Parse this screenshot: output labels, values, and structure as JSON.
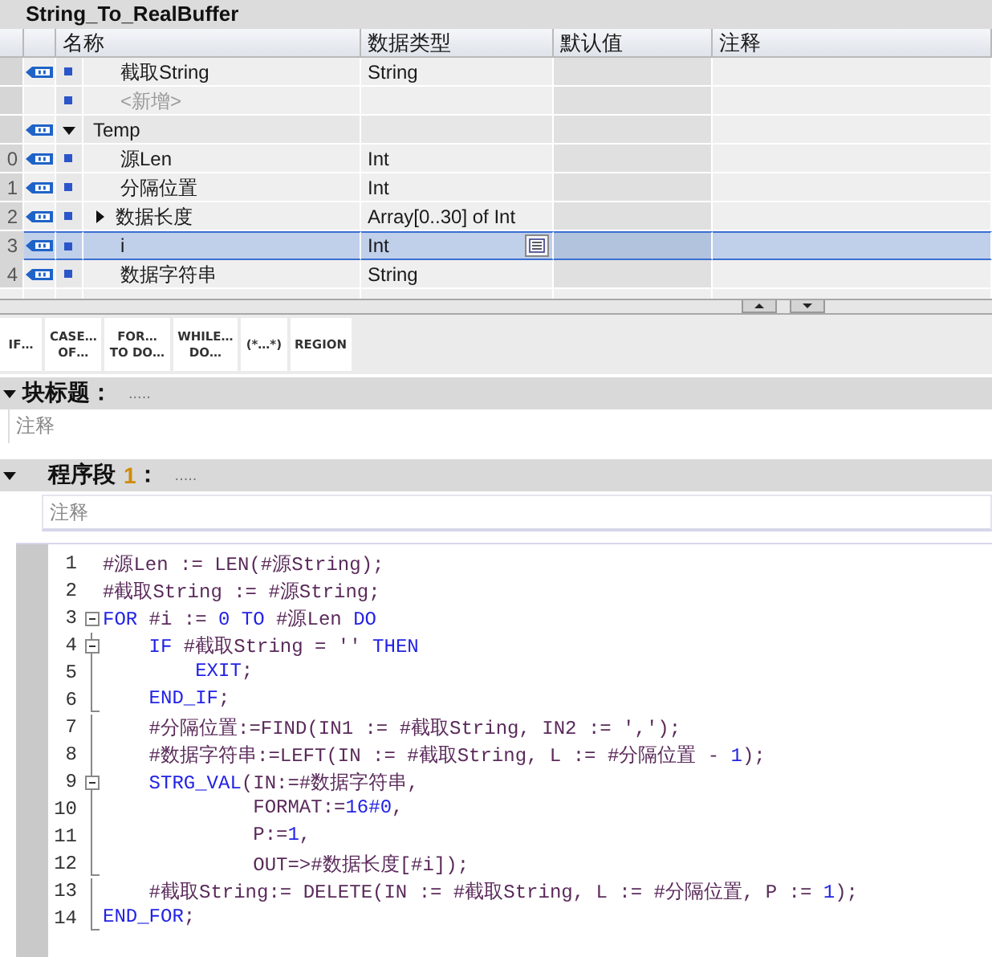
{
  "block": {
    "title": "String_To_RealBuffer"
  },
  "table": {
    "columns": [
      "名称",
      "数据类型",
      "默认值",
      "注释"
    ],
    "rows": [
      {
        "kind": "member",
        "name": "截取String",
        "type": "String",
        "selected": false
      },
      {
        "kind": "add",
        "name": "<新增>",
        "selected": false
      },
      {
        "kind": "section",
        "name": "Temp",
        "expanded": true,
        "selected": false
      },
      {
        "number": "0",
        "kind": "member",
        "name": "源Len",
        "type": "Int",
        "selected": false
      },
      {
        "number": "1",
        "kind": "member",
        "name": "分隔位置",
        "type": "Int",
        "selected": false
      },
      {
        "number": "2",
        "kind": "member",
        "name": "数据长度",
        "type": "Array[0..30] of Int",
        "expanded": false,
        "selected": false
      },
      {
        "number": "3",
        "kind": "member",
        "name": "i",
        "type": "Int",
        "selected": true
      },
      {
        "number": "4",
        "kind": "member",
        "name": "数据字符串",
        "type": "String",
        "selected": false
      }
    ]
  },
  "toolbar": {
    "buttons": [
      "IF…",
      "CASE…\nOF…",
      "FOR…\nTO DO…",
      "WHILE…\nDO…",
      "(*…*)",
      "REGION"
    ]
  },
  "block_title": {
    "label": "块标题：",
    "hint": ".....",
    "expanded": true,
    "comment": "注释"
  },
  "network": {
    "label": "程序段",
    "number": "1",
    "separator": "：",
    "hint": ".....",
    "expanded": true,
    "comment": "注释"
  },
  "code": {
    "lines": [
      {
        "number": "1",
        "foldable": false,
        "block_end": false,
        "segments": [
          {
            "kind": "plain",
            "text": "#源Len := LEN(#源String);"
          }
        ]
      },
      {
        "number": "2",
        "foldable": false,
        "block_end": false,
        "segments": [
          {
            "kind": "plain",
            "text": "#截取String := #源String;"
          }
        ]
      },
      {
        "number": "3",
        "foldable": true,
        "block_end": false,
        "segments": [
          {
            "kind": "keyword",
            "text": "FOR"
          },
          {
            "kind": "plain",
            "text": " #i := "
          },
          {
            "kind": "number",
            "text": "0"
          },
          {
            "kind": "keyword",
            "text": " TO"
          },
          {
            "kind": "plain",
            "text": " #源Len "
          },
          {
            "kind": "keyword",
            "text": "DO"
          }
        ]
      },
      {
        "number": "4",
        "foldable": true,
        "block_end": false,
        "segments": [
          {
            "kind": "keyword",
            "text": "    IF"
          },
          {
            "kind": "plain",
            "text": " #截取String = '' "
          },
          {
            "kind": "keyword",
            "text": "THEN"
          }
        ]
      },
      {
        "number": "5",
        "foldable": false,
        "block_end": false,
        "segments": [
          {
            "kind": "keyword",
            "text": "        EXIT"
          },
          {
            "kind": "plain",
            "text": ";"
          }
        ]
      },
      {
        "number": "6",
        "foldable": false,
        "block_end": true,
        "segments": [
          {
            "kind": "keyword",
            "text": "    END_IF"
          },
          {
            "kind": "plain",
            "text": ";"
          }
        ]
      },
      {
        "number": "7",
        "foldable": false,
        "block_end": false,
        "segments": [
          {
            "kind": "plain",
            "text": "    #分隔位置:=FIND(IN1 := #截取String, IN2 := ',');"
          }
        ]
      },
      {
        "number": "8",
        "foldable": false,
        "block_end": false,
        "segments": [
          {
            "kind": "plain",
            "text": "    #数据字符串:=LEFT(IN := #截取String, L := #分隔位置 - "
          },
          {
            "kind": "number",
            "text": "1"
          },
          {
            "kind": "plain",
            "text": ");"
          }
        ]
      },
      {
        "number": "9",
        "foldable": true,
        "block_end": false,
        "segments": [
          {
            "kind": "keyword",
            "text": "    STRG_VAL"
          },
          {
            "kind": "plain",
            "text": "(IN:=#数据字符串,"
          }
        ]
      },
      {
        "number": "10",
        "foldable": false,
        "block_end": false,
        "segments": [
          {
            "kind": "plain",
            "text": "             FORMAT:="
          },
          {
            "kind": "number",
            "text": "16#0"
          },
          {
            "kind": "plain",
            "text": ","
          }
        ]
      },
      {
        "number": "11",
        "foldable": false,
        "block_end": false,
        "segments": [
          {
            "kind": "plain",
            "text": "             P:="
          },
          {
            "kind": "number",
            "text": "1"
          },
          {
            "kind": "plain",
            "text": ","
          }
        ]
      },
      {
        "number": "12",
        "foldable": false,
        "block_end": true,
        "segments": [
          {
            "kind": "plain",
            "text": "             OUT=>#数据长度[#i]);"
          }
        ]
      },
      {
        "number": "13",
        "foldable": false,
        "block_end": false,
        "segments": [
          {
            "kind": "plain",
            "text": "    #截取String:= DELETE(IN := #截取String, L := #分隔位置, P := "
          },
          {
            "kind": "number",
            "text": "1"
          },
          {
            "kind": "plain",
            "text": ");"
          }
        ]
      },
      {
        "number": "14",
        "foldable": false,
        "block_end": true,
        "segments": [
          {
            "kind": "keyword",
            "text": "END_FOR"
          },
          {
            "kind": "plain",
            "text": ";"
          }
        ]
      }
    ]
  }
}
